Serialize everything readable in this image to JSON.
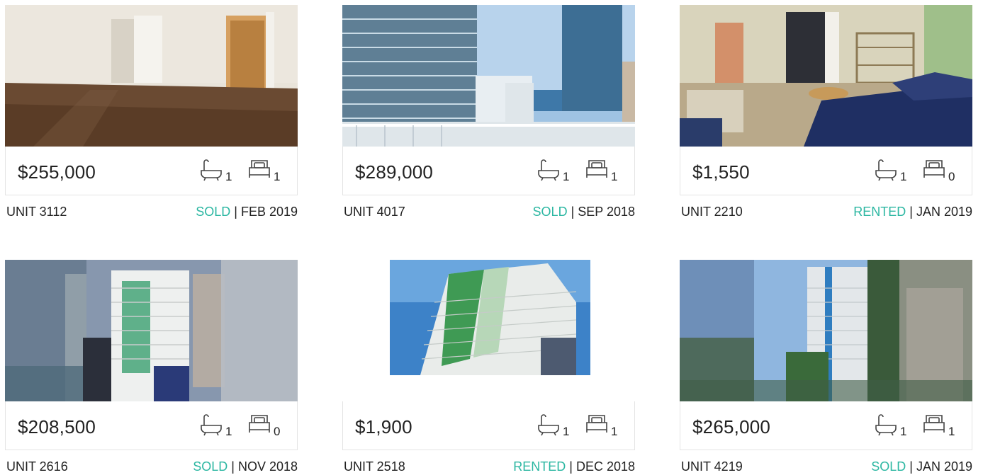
{
  "listings": [
    {
      "price": "$255,000",
      "baths": "1",
      "beds": "1",
      "unit": "UNIT 3112",
      "status": "SOLD",
      "date": " | FEB 2019"
    },
    {
      "price": "$289,000",
      "baths": "1",
      "beds": "1",
      "unit": "UNIT 4017",
      "status": "SOLD",
      "date": " | SEP 2018"
    },
    {
      "price": "$1,550",
      "baths": "1",
      "beds": "0",
      "unit": "UNIT 2210",
      "status": "RENTED",
      "date": " | JAN 2019"
    },
    {
      "price": "$208,500",
      "baths": "1",
      "beds": "0",
      "unit": "UNIT 2616",
      "status": "SOLD",
      "date": " | NOV 2018"
    },
    {
      "price": "$1,900",
      "baths": "1",
      "beds": "1",
      "unit": "UNIT 2518",
      "status": "RENTED",
      "date": " | DEC 2018"
    },
    {
      "price": "$265,000",
      "baths": "1",
      "beds": "1",
      "unit": "UNIT 4219",
      "status": "SOLD",
      "date": " | JAN 2019"
    }
  ],
  "icons": {
    "bath": "bathtub-icon",
    "bed": "bed-icon"
  },
  "colors": {
    "status": "#2cb7a2",
    "text": "#222222",
    "border": "#e4e4e4"
  }
}
